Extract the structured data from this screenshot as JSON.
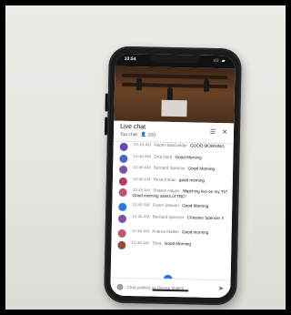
{
  "status": {
    "time": "10:54",
    "icons": "ıll ▰"
  },
  "chat": {
    "title": "Live chat",
    "subtitle": "Top chat",
    "viewers": "100",
    "menu_icon": "menu-icon",
    "close_icon": "close-icon"
  },
  "messages": [
    {
      "time": "10:45 AM",
      "author": "Naomi Batchelder",
      "text": "GOOD MORNING",
      "avatar_color": "#6a4bb3"
    },
    {
      "time": "10:46 AM",
      "author": "Zina Nord",
      "text": "Good Morning",
      "avatar_color": "#4a67c8"
    },
    {
      "time": "10:46 AM",
      "author": "Bernard Spencer",
      "text": "Good Morning",
      "avatar_color": "#7c4fa8"
    },
    {
      "time": "10:46 AM",
      "author": "Rena Inman",
      "text": "good morning",
      "avatar_color": "#b43c62"
    },
    {
      "time": "10:46 AM",
      "author": "Sharon Hayes",
      "text": "Watching live on my TV! Good morning saints of TBC!",
      "avatar_color": "#c2536a"
    },
    {
      "time": "10:46 AM",
      "author": "Gwen Stewart",
      "text": "Good Morning",
      "avatar_color": "#2b7bd6"
    },
    {
      "time": "10:46 AM",
      "author": "Bernard Spencer",
      "text": "Christine Spencer !!",
      "avatar_color": "#7c4fa8"
    },
    {
      "time": "10:46 AM",
      "author": "Andrea Mallett",
      "text": "Good morning",
      "avatar_color": "#c05a70"
    },
    {
      "time": "10:46 AM",
      "author": "Thea",
      "text": "Good Morning",
      "avatar_color": "#8e4f3b"
    }
  ],
  "input": {
    "placeholder": "Chat publicly as Denise Mallett..."
  }
}
